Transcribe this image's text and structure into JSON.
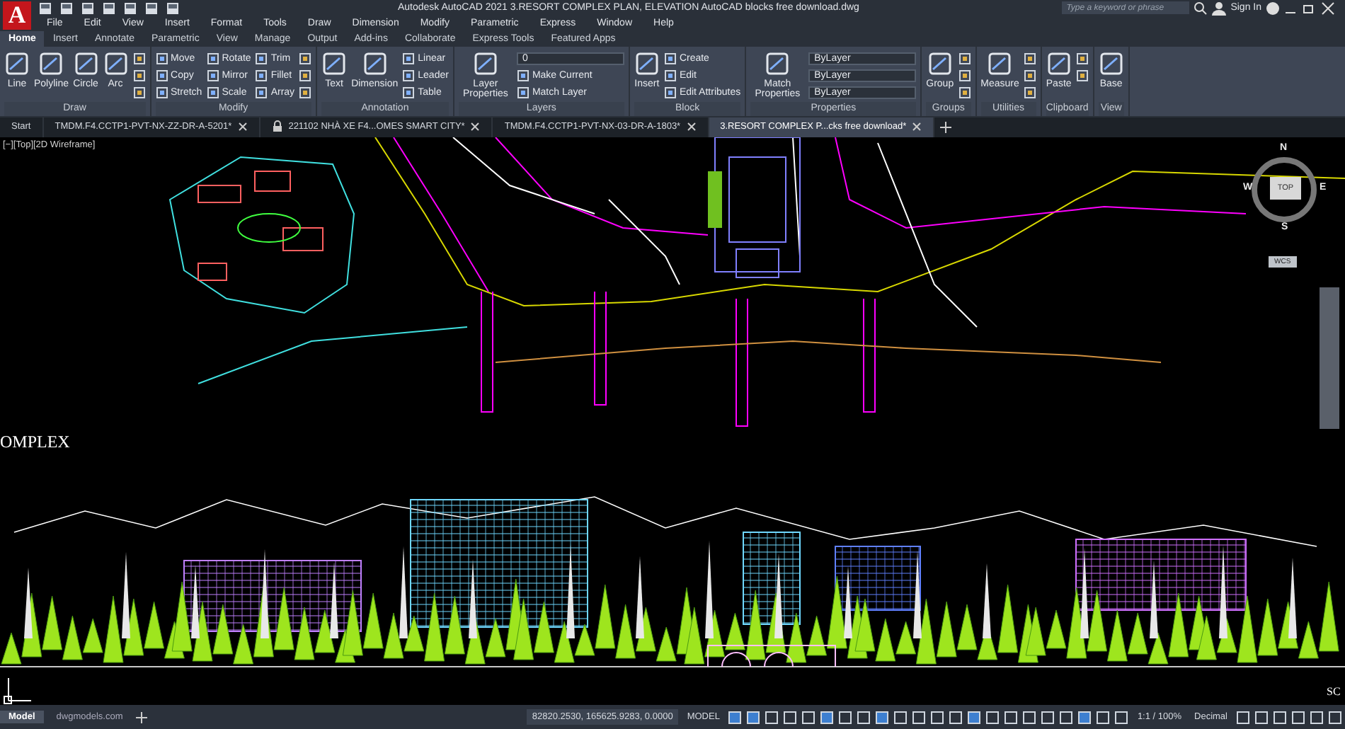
{
  "title_bar": {
    "logo": "A",
    "title": "Autodesk AutoCAD 2021   3.RESORT COMPLEX PLAN, ELEVATION AutoCAD blocks free download.dwg",
    "search": {
      "placeholder": "Type a keyword or phrase"
    },
    "sign_in": "Sign In"
  },
  "menu": [
    "File",
    "Edit",
    "View",
    "Insert",
    "Format",
    "Tools",
    "Draw",
    "Dimension",
    "Modify",
    "Parametric",
    "Express",
    "Window",
    "Help"
  ],
  "ribbon_tabs": [
    {
      "label": "Home",
      "selected": true
    },
    {
      "label": "Insert",
      "selected": false
    },
    {
      "label": "Annotate",
      "selected": false
    },
    {
      "label": "Parametric",
      "selected": false
    },
    {
      "label": "View",
      "selected": false
    },
    {
      "label": "Manage",
      "selected": false
    },
    {
      "label": "Output",
      "selected": false
    },
    {
      "label": "Add-ins",
      "selected": false
    },
    {
      "label": "Collaborate",
      "selected": false
    },
    {
      "label": "Express Tools",
      "selected": false
    },
    {
      "label": "Featured Apps",
      "selected": false
    }
  ],
  "panels": [
    {
      "title": "Draw",
      "tools": [
        {
          "kind": "large",
          "label": "Line"
        },
        {
          "kind": "large",
          "label": "Polyline"
        },
        {
          "kind": "large",
          "label": "Circle"
        },
        {
          "kind": "large",
          "label": "Arc"
        },
        {
          "kind": "icon"
        },
        {
          "kind": "icon"
        },
        {
          "kind": "icon"
        }
      ]
    },
    {
      "title": "Modify",
      "tools": [
        {
          "kind": "small",
          "label": "Move"
        },
        {
          "kind": "small",
          "label": "Copy"
        },
        {
          "kind": "small",
          "label": "Stretch"
        },
        {
          "kind": "small",
          "label": "Rotate"
        },
        {
          "kind": "small",
          "label": "Mirror"
        },
        {
          "kind": "small",
          "label": "Scale"
        },
        {
          "kind": "small",
          "label": "Trim"
        },
        {
          "kind": "small",
          "label": "Fillet"
        },
        {
          "kind": "small",
          "label": "Array"
        },
        {
          "kind": "icon"
        },
        {
          "kind": "icon"
        },
        {
          "kind": "icon"
        }
      ]
    },
    {
      "title": "Annotation",
      "tools": [
        {
          "kind": "large",
          "label": "Text"
        },
        {
          "kind": "large",
          "label": "Dimension"
        },
        {
          "kind": "small",
          "label": "Linear"
        },
        {
          "kind": "small",
          "label": "Leader"
        },
        {
          "kind": "small",
          "label": "Table"
        }
      ]
    },
    {
      "title": "Layers",
      "tools": [
        {
          "kind": "large",
          "label": "Layer Properties"
        },
        {
          "kind": "dropdown",
          "label": "0"
        },
        {
          "kind": "small",
          "label": "Make Current"
        },
        {
          "kind": "small",
          "label": "Match Layer"
        }
      ]
    },
    {
      "title": "Block",
      "tools": [
        {
          "kind": "large",
          "label": "Insert"
        },
        {
          "kind": "small",
          "label": "Create"
        },
        {
          "kind": "small",
          "label": "Edit"
        },
        {
          "kind": "small",
          "label": "Edit Attributes"
        }
      ]
    },
    {
      "title": "Properties",
      "tools": [
        {
          "kind": "large",
          "label": "Match Properties"
        },
        {
          "kind": "dropdown",
          "label": "ByLayer"
        },
        {
          "kind": "dropdown",
          "label": "ByLayer"
        },
        {
          "kind": "dropdown",
          "label": "ByLayer"
        }
      ]
    },
    {
      "title": "Groups",
      "tools": [
        {
          "kind": "large",
          "label": "Group"
        },
        {
          "kind": "icon"
        },
        {
          "kind": "icon"
        },
        {
          "kind": "icon"
        }
      ]
    },
    {
      "title": "Utilities",
      "tools": [
        {
          "kind": "large",
          "label": "Measure"
        },
        {
          "kind": "icon"
        },
        {
          "kind": "icon"
        },
        {
          "kind": "icon"
        }
      ]
    },
    {
      "title": "Clipboard",
      "tools": [
        {
          "kind": "large",
          "label": "Paste"
        },
        {
          "kind": "icon"
        },
        {
          "kind": "icon"
        }
      ]
    },
    {
      "title": "View",
      "tools": [
        {
          "kind": "large",
          "label": "Base"
        }
      ]
    }
  ],
  "doc_tabs": [
    {
      "label": "Start",
      "selected": false,
      "locked": false
    },
    {
      "label": "TMDM.F4.CCTP1-PVT-NX-ZZ-DR-A-5201*",
      "selected": false,
      "locked": false
    },
    {
      "label": "221102 NHÀ XE F4...OMES SMART CITY*",
      "selected": false,
      "locked": true
    },
    {
      "label": "TMDM.F4.CCTP1-PVT-NX-03-DR-A-1803*",
      "selected": false,
      "locked": false
    },
    {
      "label": "3.RESORT COMPLEX P...cks free download*",
      "selected": true,
      "locked": false
    }
  ],
  "viewport": {
    "label": "[−][Top][2D Wireframe]",
    "drawing_texts": [
      "OMPLEX",
      "SC"
    ],
    "viewcube": {
      "north": "N",
      "south": "S",
      "east": "E",
      "west": "W",
      "face": "TOP",
      "ucs": "WCS"
    }
  },
  "status_bar": {
    "layouts": [
      {
        "label": "Model",
        "selected": true
      },
      {
        "label": "dwgmodels.com",
        "selected": false
      }
    ],
    "coordinates": "82820.2530, 165625.9283, 0.0000",
    "space": "MODEL",
    "scale": "1:1 / 100%",
    "units": "Decimal"
  }
}
